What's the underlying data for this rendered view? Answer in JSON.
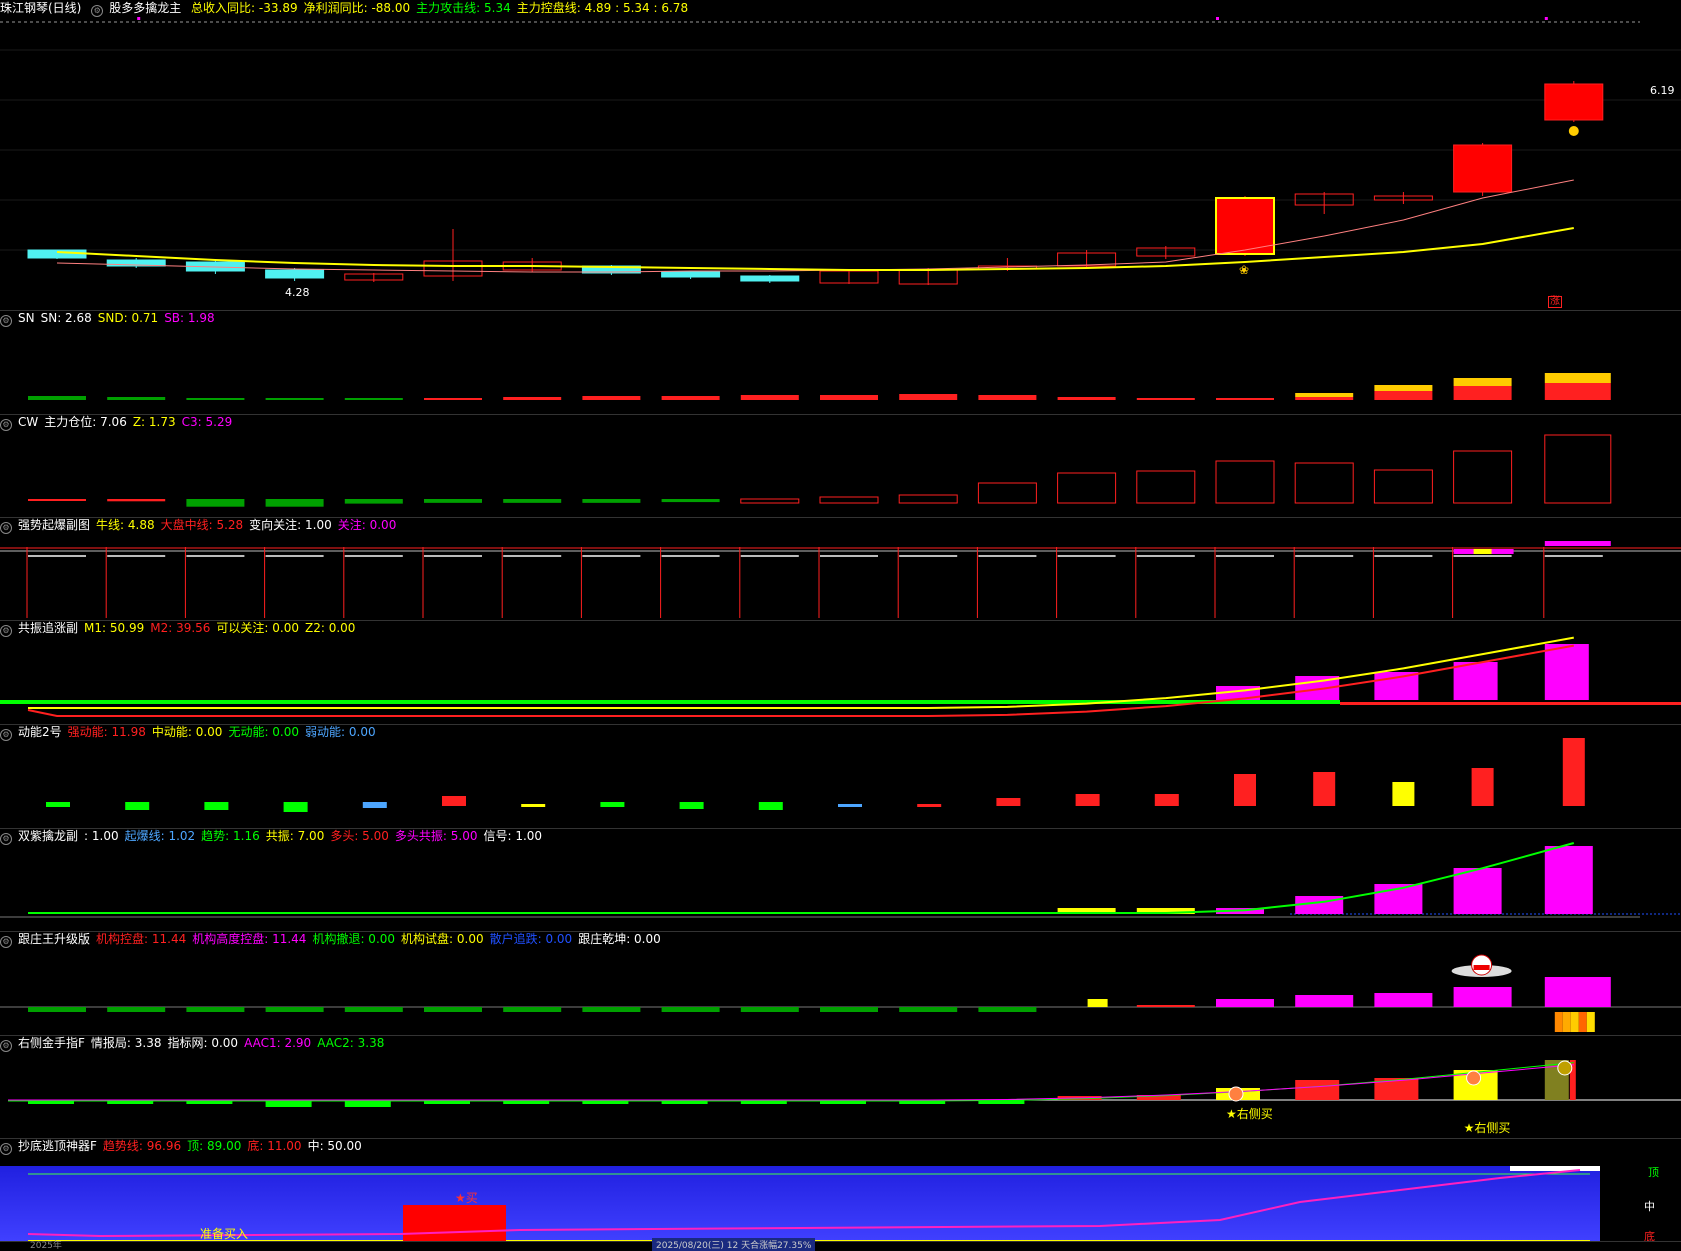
{
  "main": {
    "title": "珠江钢琴(日线)",
    "indicator_name": "股多多擒龙主",
    "fields": [
      {
        "label": "总收入同比:",
        "value": "-33.89",
        "color": "#ffff00"
      },
      {
        "label": "净利润同比:",
        "value": "-88.00",
        "color": "#ffff00"
      },
      {
        "label": "主力攻击线:",
        "value": "5.34",
        "color": "#00ff00"
      },
      {
        "label": "主力控盘线:",
        "value": "4.89 : 5.34 : 6.78",
        "color": "#ffff00"
      }
    ],
    "high_label": "6.19",
    "low_label": "4.28",
    "tag_char": "涨"
  },
  "panels": [
    {
      "id": "sn",
      "name": "SN",
      "fields": [
        {
          "label": "SN:",
          "value": "2.68",
          "color": "#ffffff"
        },
        {
          "label": "SND:",
          "value": "0.71",
          "color": "#ffff00"
        },
        {
          "label": "SB:",
          "value": "1.98",
          "color": "#ff00ff"
        }
      ]
    },
    {
      "id": "cw",
      "name": "CW",
      "fields": [
        {
          "label": "主力仓位:",
          "value": "7.06",
          "color": "#ffffff"
        },
        {
          "label": "Z:",
          "value": "1.73",
          "color": "#ffff00"
        },
        {
          "label": "C3:",
          "value": "5.29",
          "color": "#ff00ff"
        }
      ]
    },
    {
      "id": "qs",
      "name": "强势起爆副图",
      "fields": [
        {
          "label": "牛线:",
          "value": "4.88",
          "color": "#ffff00"
        },
        {
          "label": "大盘中线:",
          "value": "5.28",
          "color": "#ff2020"
        },
        {
          "label": "变向关注:",
          "value": "1.00",
          "color": "#ffffff"
        },
        {
          "label": "关注:",
          "value": "0.00",
          "color": "#ff00ff"
        }
      ]
    },
    {
      "id": "gz",
      "name": "共振追涨副",
      "fields": [
        {
          "label": "M1:",
          "value": "50.99",
          "color": "#ffff00"
        },
        {
          "label": "M2:",
          "value": "39.56",
          "color": "#ff2020"
        },
        {
          "label": "可以关注:",
          "value": "0.00",
          "color": "#ffff00"
        },
        {
          "label": "Z2:",
          "value": "0.00",
          "color": "#ffff00"
        }
      ]
    },
    {
      "id": "dn",
      "name": "动能2号",
      "fields": [
        {
          "label": "强动能:",
          "value": "11.98",
          "color": "#ff2020"
        },
        {
          "label": "中动能:",
          "value": "0.00",
          "color": "#ffff00"
        },
        {
          "label": "无动能:",
          "value": "0.00",
          "color": "#00ff00"
        },
        {
          "label": "弱动能:",
          "value": "0.00",
          "color": "#4da6ff"
        }
      ]
    },
    {
      "id": "sz",
      "name": "双紫擒龙副",
      "fields": [
        {
          "label": ":",
          "value": "1.00",
          "color": "#ffffff"
        },
        {
          "label": "起爆线:",
          "value": "1.02",
          "color": "#4da6ff"
        },
        {
          "label": "趋势:",
          "value": "1.16",
          "color": "#00ff00"
        },
        {
          "label": "共振:",
          "value": "7.00",
          "color": "#ffff00"
        },
        {
          "label": "多头:",
          "value": "5.00",
          "color": "#ff2020"
        },
        {
          "label": "多头共振:",
          "value": "5.00",
          "color": "#ff00ff"
        },
        {
          "label": "信号:",
          "value": "1.00",
          "color": "#ffffff"
        }
      ]
    },
    {
      "id": "gzw",
      "name": "跟庄王升级版",
      "fields": [
        {
          "label": "机构控盘:",
          "value": "11.44",
          "color": "#ff2020"
        },
        {
          "label": "机构高度控盘:",
          "value": "11.44",
          "color": "#ff00ff"
        },
        {
          "label": "机构撤退:",
          "value": "0.00",
          "color": "#00ff00"
        },
        {
          "label": "机构试盘:",
          "value": "0.00",
          "color": "#ffff00"
        },
        {
          "label": "散户追跌:",
          "value": "0.00",
          "color": "#2050ff"
        },
        {
          "label": "跟庄乾坤:",
          "value": "0.00",
          "color": "#ffffff"
        }
      ]
    },
    {
      "id": "yc",
      "name": "右侧金手指F",
      "fields": [
        {
          "label": "情报局:",
          "value": "3.38",
          "color": "#ffffff"
        },
        {
          "label": "指标网:",
          "value": "0.00",
          "color": "#ffffff"
        },
        {
          "label": "AAC1:",
          "value": "2.90",
          "color": "#ff00ff"
        },
        {
          "label": "AAC2:",
          "value": "3.38",
          "color": "#00ff00"
        }
      ],
      "buy_label": "★右侧买"
    },
    {
      "id": "cd",
      "name": "抄底逃顶神器F",
      "fields": [
        {
          "label": "趋势线:",
          "value": "96.96",
          "color": "#ff2020"
        },
        {
          "label": "顶:",
          "value": "89.00",
          "color": "#00ff00"
        },
        {
          "label": "底:",
          "value": "11.00",
          "color": "#ff2020"
        },
        {
          "label": "中:",
          "value": "50.00",
          "color": "#ffffff"
        }
      ],
      "prepare_label": "准备买入",
      "buy_mark": "★买",
      "right_top": "顶",
      "right_mid": "中",
      "right_bot": "底"
    }
  ],
  "footer": {
    "left": "2025年",
    "center": "2025/08/20(三)   12 天合涨幅27.35%"
  },
  "colors": {
    "up": "#ff2020",
    "down": "#50f0f0",
    "ma1": "#ffff00",
    "ma2": "#ff8080",
    "magenta": "#ff00ff",
    "green": "#00c000",
    "yellow": "#ffff00"
  }
}
